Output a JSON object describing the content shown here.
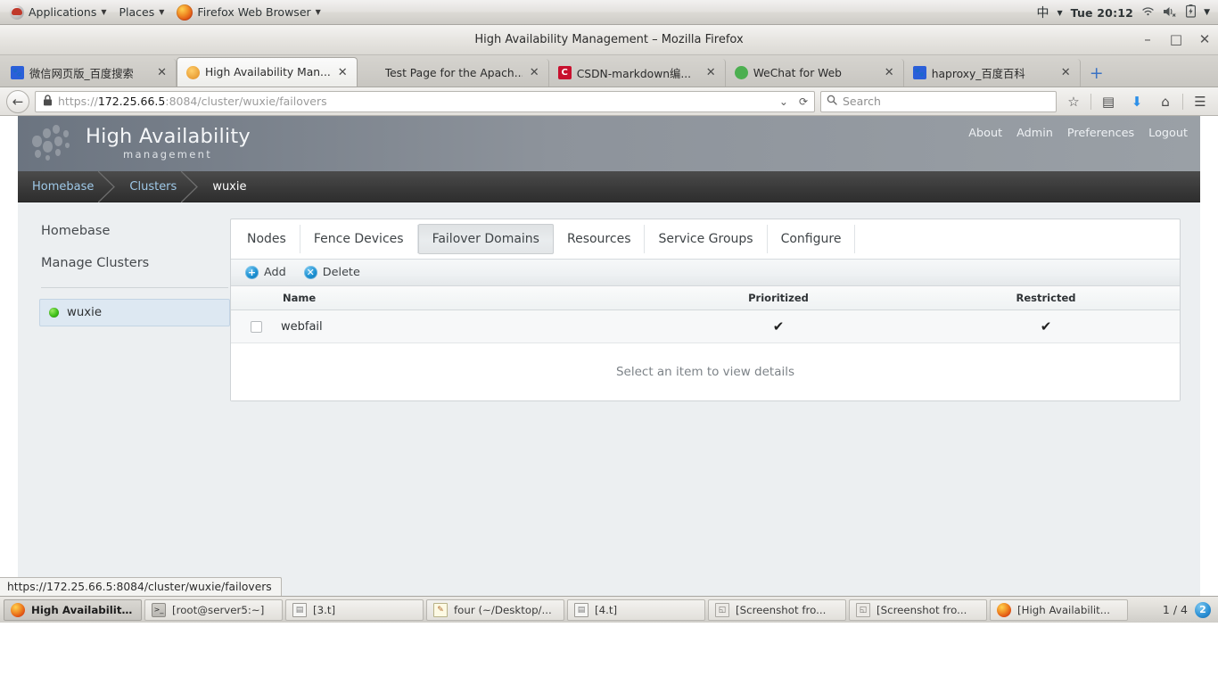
{
  "desktop_panel": {
    "applications_label": "Applications",
    "places_label": "Places",
    "app_label": "Firefox Web Browser",
    "input_method": "中",
    "clock": "Tue 20:12",
    "icons": [
      "fedora-icon",
      "firefox-icon",
      "wifi-icon",
      "volume-muted-icon",
      "battery-charging-icon",
      "chevron-down-icon"
    ]
  },
  "browser": {
    "window_title": "High Availability Management – Mozilla Firefox",
    "window_buttons": {
      "minimize": "–",
      "maximize": "□",
      "close": "✕"
    },
    "tabs": [
      {
        "title": "微信网页版_百度搜索",
        "favicon": "baidu-icon",
        "active": false,
        "close": "✕"
      },
      {
        "title": "High Availability Man...",
        "favicon": "ha-gear-icon",
        "active": true,
        "close": "✕"
      },
      {
        "title": "Test Page for the Apach...",
        "favicon": "blank-icon",
        "active": false,
        "close": "✕"
      },
      {
        "title": "CSDN-markdown编...",
        "favicon": "csdn-icon",
        "active": false,
        "close": "✕"
      },
      {
        "title": "WeChat for Web",
        "favicon": "wechat-icon",
        "active": false,
        "close": "✕"
      },
      {
        "title": "haproxy_百度百科",
        "favicon": "baidu-icon",
        "active": false,
        "close": "✕"
      }
    ],
    "new_tab_label": "+",
    "back_label": "←",
    "urlbar": {
      "scheme": "https://",
      "host": "172.25.66.5",
      "rest": ":8084/cluster/wuxie/failovers",
      "full": "https://172.25.66.5:8084/cluster/wuxie/failovers",
      "lock_icon": "lock-icon",
      "dropdown_icon": "chevron-down-icon",
      "reload_icon": "reload-icon"
    },
    "search": {
      "placeholder": "Search",
      "icon": "search-icon"
    },
    "toolbar_icons": [
      "bookmark-star-icon",
      "reader-list-icon",
      "downloads-icon",
      "home-icon",
      "hamburger-menu-icon"
    ]
  },
  "app": {
    "brand_title": "High Availability",
    "brand_subtitle": "management",
    "topnav": [
      "About",
      "Admin",
      "Preferences",
      "Logout"
    ],
    "breadcrumb": [
      "Homebase",
      "Clusters",
      "wuxie"
    ],
    "sidebar": {
      "links": [
        "Homebase",
        "Manage Clusters"
      ],
      "clusters": [
        {
          "name": "wuxie",
          "status_color": "#3fc11a",
          "selected": true
        }
      ]
    },
    "tabs": [
      {
        "label": "Nodes",
        "active": false
      },
      {
        "label": "Fence Devices",
        "active": false
      },
      {
        "label": "Failover Domains",
        "active": true
      },
      {
        "label": "Resources",
        "active": false
      },
      {
        "label": "Service Groups",
        "active": false
      },
      {
        "label": "Configure",
        "active": false
      }
    ],
    "toolbar": {
      "add_label": "Add",
      "add_icon": "plus-circle-icon",
      "delete_label": "Delete",
      "delete_icon": "x-circle-icon"
    },
    "table": {
      "columns": [
        "",
        "Name",
        "Prioritized",
        "Restricted"
      ],
      "rows": [
        {
          "checked": false,
          "name": "webfail",
          "prioritized": "✔",
          "restricted": "✔"
        }
      ]
    },
    "details_placeholder": "Select an item to view details"
  },
  "status_url": "https://172.25.66.5:8084/cluster/wuxie/failovers",
  "taskbar": {
    "items": [
      {
        "label": "High Availability ...",
        "icon": "firefox-icon",
        "active": true
      },
      {
        "label": "[root@server5:~]",
        "icon": "terminal-icon",
        "active": false
      },
      {
        "label": "[3.t]",
        "icon": "document-icon",
        "active": false
      },
      {
        "label": "four (~/Desktop/...",
        "icon": "notes-icon",
        "active": false
      },
      {
        "label": "[4.t]",
        "icon": "document-icon",
        "active": false
      },
      {
        "label": "[Screenshot fro...",
        "icon": "screenshot-icon",
        "active": false
      },
      {
        "label": "[Screenshot fro...",
        "icon": "screenshot-icon",
        "active": false
      },
      {
        "label": "[High Availabilit...",
        "icon": "firefox-icon",
        "active": false
      }
    ],
    "workspace_label": "1 / 4",
    "workspace_badge": "2"
  }
}
